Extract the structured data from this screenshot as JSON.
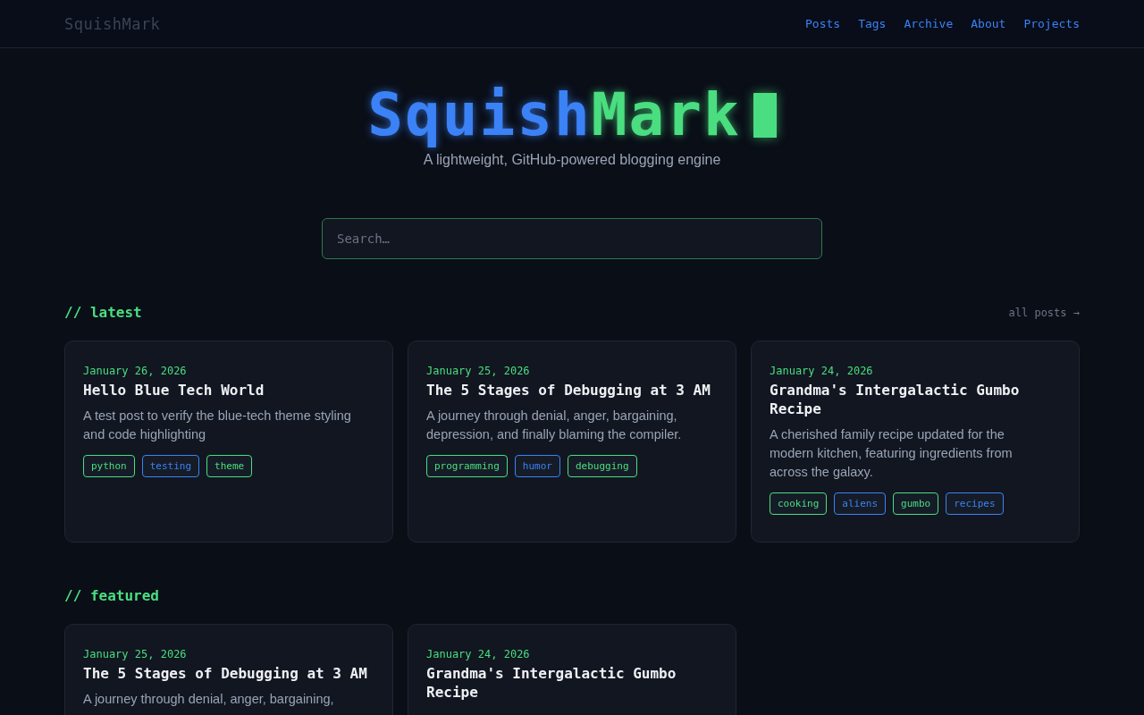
{
  "header": {
    "logo": "SquishMark",
    "nav": [
      {
        "label": "Posts"
      },
      {
        "label": "Tags"
      },
      {
        "label": "Archive"
      },
      {
        "label": "About"
      },
      {
        "label": "Projects"
      }
    ]
  },
  "hero": {
    "title_part_1": "Squish",
    "title_part_2": "Mark",
    "tagline": "A lightweight, GitHub-powered blogging engine"
  },
  "search": {
    "placeholder": "Search…"
  },
  "sections": [
    {
      "heading": "// latest",
      "link": "all posts →",
      "posts": [
        {
          "date": "January 26, 2026",
          "title": "Hello Blue Tech World",
          "summary": "A test post to verify the blue-tech theme styling and code highlighting",
          "tags": [
            {
              "label": "python",
              "color": "#4ade80"
            },
            {
              "label": "testing",
              "color": "#3b82f6"
            },
            {
              "label": "theme",
              "color": "#4ade80"
            }
          ]
        },
        {
          "date": "January 25, 2026",
          "title": "The 5 Stages of Debugging at 3 AM",
          "summary": "A journey through denial, anger, bargaining, depression, and finally blaming the compiler.",
          "tags": [
            {
              "label": "programming",
              "color": "#4ade80"
            },
            {
              "label": "humor",
              "color": "#3b82f6"
            },
            {
              "label": "debugging",
              "color": "#4ade80"
            }
          ]
        },
        {
          "date": "January 24, 2026",
          "title": "Grandma's Intergalactic Gumbo Recipe",
          "summary": "A cherished family recipe updated for the modern kitchen, featuring ingredients from across the galaxy.",
          "tags": [
            {
              "label": "cooking",
              "color": "#4ade80"
            },
            {
              "label": "aliens",
              "color": "#3b82f6"
            },
            {
              "label": "gumbo",
              "color": "#4ade80"
            },
            {
              "label": "recipes",
              "color": "#3b82f6"
            }
          ]
        }
      ]
    },
    {
      "heading": "// featured",
      "posts": [
        {
          "date": "January 25, 2026",
          "title": "The 5 Stages of Debugging at 3 AM",
          "summary": "A journey through denial, anger, bargaining,"
        },
        {
          "date": "January 24, 2026",
          "title": "Grandma's Intergalactic Gumbo Recipe"
        }
      ]
    }
  ]
}
